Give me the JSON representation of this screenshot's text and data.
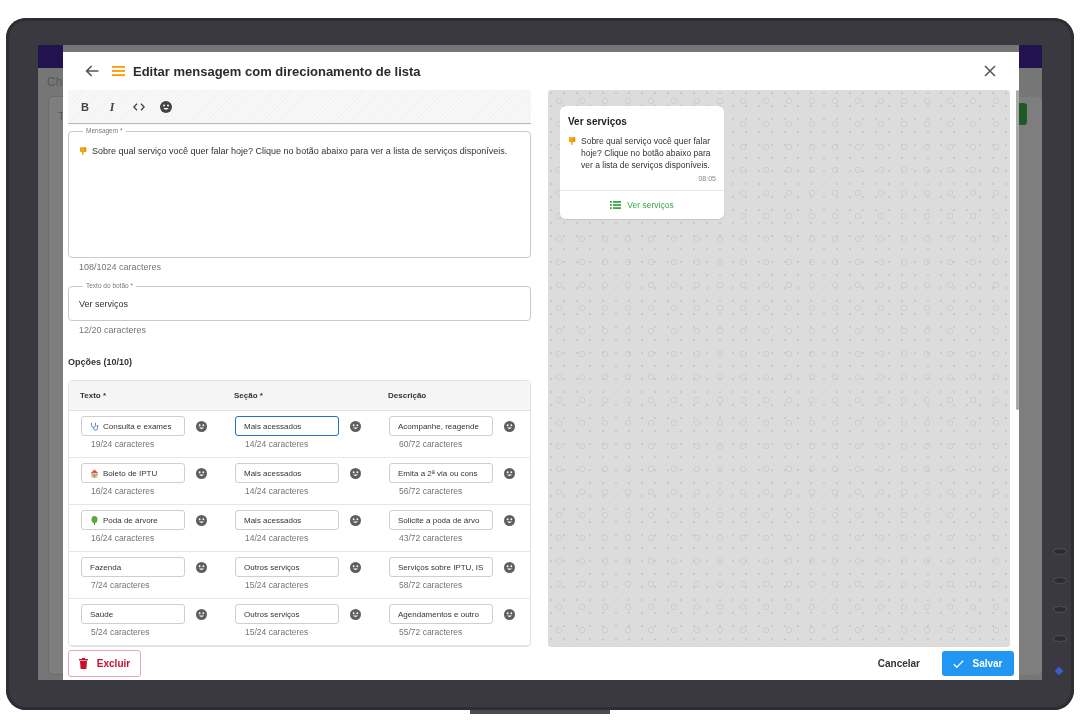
{
  "background_app": {
    "heading": "Ch",
    "label": "T"
  },
  "dialog": {
    "title": "Editar mensagem com direcionamento de lista"
  },
  "toolbar": [
    {
      "kind": "bold",
      "label": "B"
    },
    {
      "kind": "italic",
      "label": "I"
    },
    {
      "kind": "code"
    },
    {
      "kind": "emoji"
    }
  ],
  "message": {
    "label": "Mensagem *",
    "value": "Sobre qual serviço você quer falar hoje? Clique no botão abaixo para ver a lista de serviços disponíveis.",
    "counter": "108/1024 caracteres"
  },
  "button_text": {
    "label": "Texto do botão *",
    "value": "Ver serviços",
    "counter": "12/20 caracteres"
  },
  "options": {
    "heading": "Opções (10/10)",
    "columns": [
      "Texto *",
      "Seção *",
      "Descrição"
    ],
    "rows": [
      {
        "cells": [
          {
            "kind": "emoji",
            "value": "Consulta e exames",
            "counter": "19/24 caracteres",
            "focused": false
          },
          {
            "kind": "plain",
            "value": "Mais acessados",
            "counter": "14/24 caracteres",
            "focused": true
          },
          {
            "kind": "plain",
            "value": "Acompanhe, reagende",
            "counter": "60/72 caracteres",
            "focused": false
          }
        ]
      },
      {
        "cells": [
          {
            "kind": "emoji",
            "value": "Boleto de IPTU",
            "counter": "16/24 caracteres",
            "focused": false
          },
          {
            "kind": "plain",
            "value": "Mais acessados",
            "counter": "14/24 caracteres",
            "focused": false
          },
          {
            "kind": "plain",
            "value": "Emita a 2ª via ou cons",
            "counter": "56/72 caracteres",
            "focused": false
          }
        ]
      },
      {
        "cells": [
          {
            "kind": "emoji",
            "value": "Poda de árvore",
            "counter": "16/24 caracteres",
            "focused": false
          },
          {
            "kind": "plain",
            "value": "Mais acessados",
            "counter": "14/24 caracteres",
            "focused": false
          },
          {
            "kind": "plain",
            "value": "Solicite a poda de árvo",
            "counter": "43/72 caracteres",
            "focused": false
          }
        ]
      },
      {
        "cells": [
          {
            "kind": "plain",
            "value": "Fazenda",
            "counter": "7/24 caracteres",
            "focused": false
          },
          {
            "kind": "plain",
            "value": "Outros serviços",
            "counter": "15/24 caracteres",
            "focused": false
          },
          {
            "kind": "plain",
            "value": "Serviços sobre IPTU, IS",
            "counter": "58/72 caracteres",
            "focused": false
          }
        ]
      },
      {
        "cells": [
          {
            "kind": "plain",
            "value": "Saúde",
            "counter": "5/24 caracteres",
            "focused": false
          },
          {
            "kind": "plain",
            "value": "Outros serviços",
            "counter": "15/24 caracteres",
            "focused": false
          },
          {
            "kind": "plain",
            "value": "Agendamentos e outro",
            "counter": "55/72 caracteres",
            "focused": false
          }
        ]
      }
    ]
  },
  "preview": {
    "title": "Ver serviços",
    "text": "Sobre qual serviço você quer falar hoje? Clique no botão abaixo para ver a lista de serviços disponíveis.",
    "time": "08:05",
    "button": "Ver serviços"
  },
  "footer": {
    "delete": "Excluir",
    "cancel": "Cancelar",
    "save": "Salvar"
  }
}
